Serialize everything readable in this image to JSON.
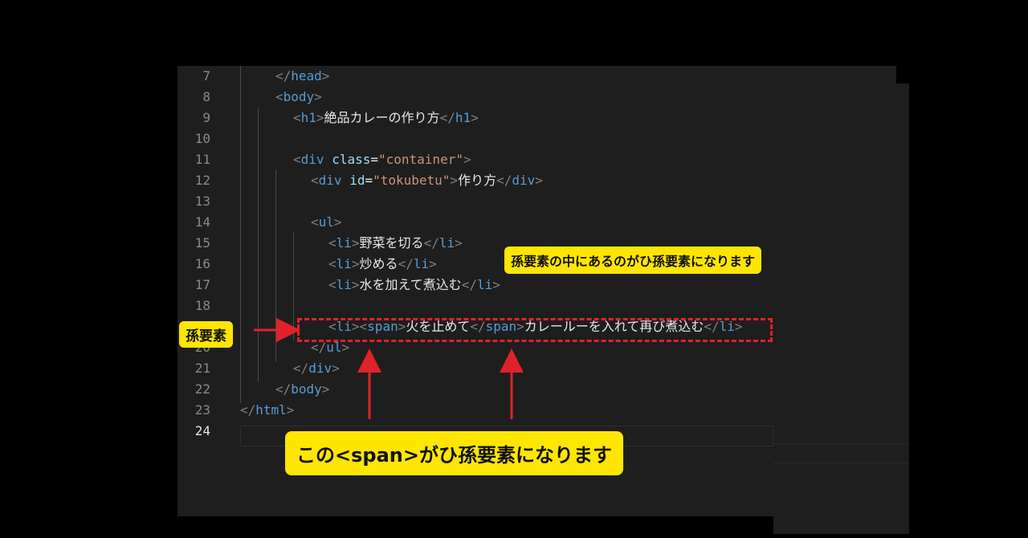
{
  "editor": {
    "lines": [
      {
        "num": "7",
        "parts": [
          [
            "t",
            "</"
          ],
          [
            "tag",
            "head"
          ],
          [
            "t",
            ">"
          ]
        ]
      },
      {
        "num": "8",
        "parts": [
          [
            "t",
            "<"
          ],
          [
            "tag",
            "body"
          ],
          [
            "t",
            ">"
          ]
        ]
      },
      {
        "num": "9",
        "parts": [
          [
            "t",
            "<"
          ],
          [
            "tag",
            "h1"
          ],
          [
            "t",
            ">"
          ],
          [
            "txt",
            "絶品カレーの作り方"
          ],
          [
            "t",
            "</"
          ],
          [
            "tag",
            "h1"
          ],
          [
            "t",
            ">"
          ]
        ]
      },
      {
        "num": "10",
        "parts": []
      },
      {
        "num": "11",
        "parts": [
          [
            "t",
            "<"
          ],
          [
            "tag",
            "div"
          ],
          [
            "txt",
            " "
          ],
          [
            "attr",
            "class"
          ],
          [
            "txt",
            "="
          ],
          [
            "str",
            "\"container\""
          ],
          [
            "t",
            ">"
          ]
        ]
      },
      {
        "num": "12",
        "parts": [
          [
            "t",
            "<"
          ],
          [
            "tag",
            "div"
          ],
          [
            "txt",
            " "
          ],
          [
            "attr",
            "id"
          ],
          [
            "txt",
            "="
          ],
          [
            "str",
            "\"tokubetu\""
          ],
          [
            "t",
            ">"
          ],
          [
            "txt",
            "作り方"
          ],
          [
            "t",
            "</"
          ],
          [
            "tag",
            "div"
          ],
          [
            "t",
            ">"
          ]
        ]
      },
      {
        "num": "13",
        "parts": []
      },
      {
        "num": "14",
        "parts": [
          [
            "t",
            "<"
          ],
          [
            "tag",
            "ul"
          ],
          [
            "t",
            ">"
          ]
        ]
      },
      {
        "num": "15",
        "parts": [
          [
            "t",
            "<"
          ],
          [
            "tag",
            "li"
          ],
          [
            "t",
            ">"
          ],
          [
            "txt",
            "野菜を切る"
          ],
          [
            "t",
            "</"
          ],
          [
            "tag",
            "li"
          ],
          [
            "t",
            ">"
          ]
        ]
      },
      {
        "num": "16",
        "parts": [
          [
            "t",
            "<"
          ],
          [
            "tag",
            "li"
          ],
          [
            "t",
            ">"
          ],
          [
            "txt",
            "炒める"
          ],
          [
            "t",
            "</"
          ],
          [
            "tag",
            "li"
          ],
          [
            "t",
            ">"
          ]
        ]
      },
      {
        "num": "17",
        "parts": [
          [
            "t",
            "<"
          ],
          [
            "tag",
            "li"
          ],
          [
            "t",
            ">"
          ],
          [
            "txt",
            "水を加えて煮込む"
          ],
          [
            "t",
            "</"
          ],
          [
            "tag",
            "li"
          ],
          [
            "t",
            ">"
          ]
        ]
      },
      {
        "num": "18",
        "parts": []
      },
      {
        "num": "19",
        "parts": [
          [
            "t",
            "<"
          ],
          [
            "tag",
            "li"
          ],
          [
            "t",
            "><"
          ],
          [
            "tag",
            "span"
          ],
          [
            "t",
            ">"
          ],
          [
            "txt",
            "火を止めて"
          ],
          [
            "t",
            "</"
          ],
          [
            "tag",
            "span"
          ],
          [
            "t",
            ">"
          ],
          [
            "txt",
            "カレールーを入れて再び煮込む"
          ],
          [
            "t",
            "</"
          ],
          [
            "tag",
            "li"
          ],
          [
            "t",
            ">"
          ]
        ]
      },
      {
        "num": "20",
        "parts": [
          [
            "t",
            "</"
          ],
          [
            "tag",
            "ul"
          ],
          [
            "t",
            ">"
          ]
        ]
      },
      {
        "num": "21",
        "parts": [
          [
            "t",
            "</"
          ],
          [
            "tag",
            "div"
          ],
          [
            "t",
            ">"
          ]
        ]
      },
      {
        "num": "22",
        "parts": [
          [
            "t",
            "</"
          ],
          [
            "tag",
            "body"
          ],
          [
            "t",
            ">"
          ]
        ]
      },
      {
        "num": "23",
        "parts": [
          [
            "t",
            "</"
          ],
          [
            "tag",
            "html"
          ],
          [
            "t",
            ">"
          ]
        ]
      },
      {
        "num": "24",
        "parts": []
      }
    ]
  },
  "annotations": {
    "left_label": "孫要素",
    "right_label": "孫要素の中にあるのがひ孫要素になります",
    "bottom_label": "この<span>がひ孫要素になります",
    "highlight_color": "#ffe600",
    "arrow_color": "#e0222a"
  }
}
